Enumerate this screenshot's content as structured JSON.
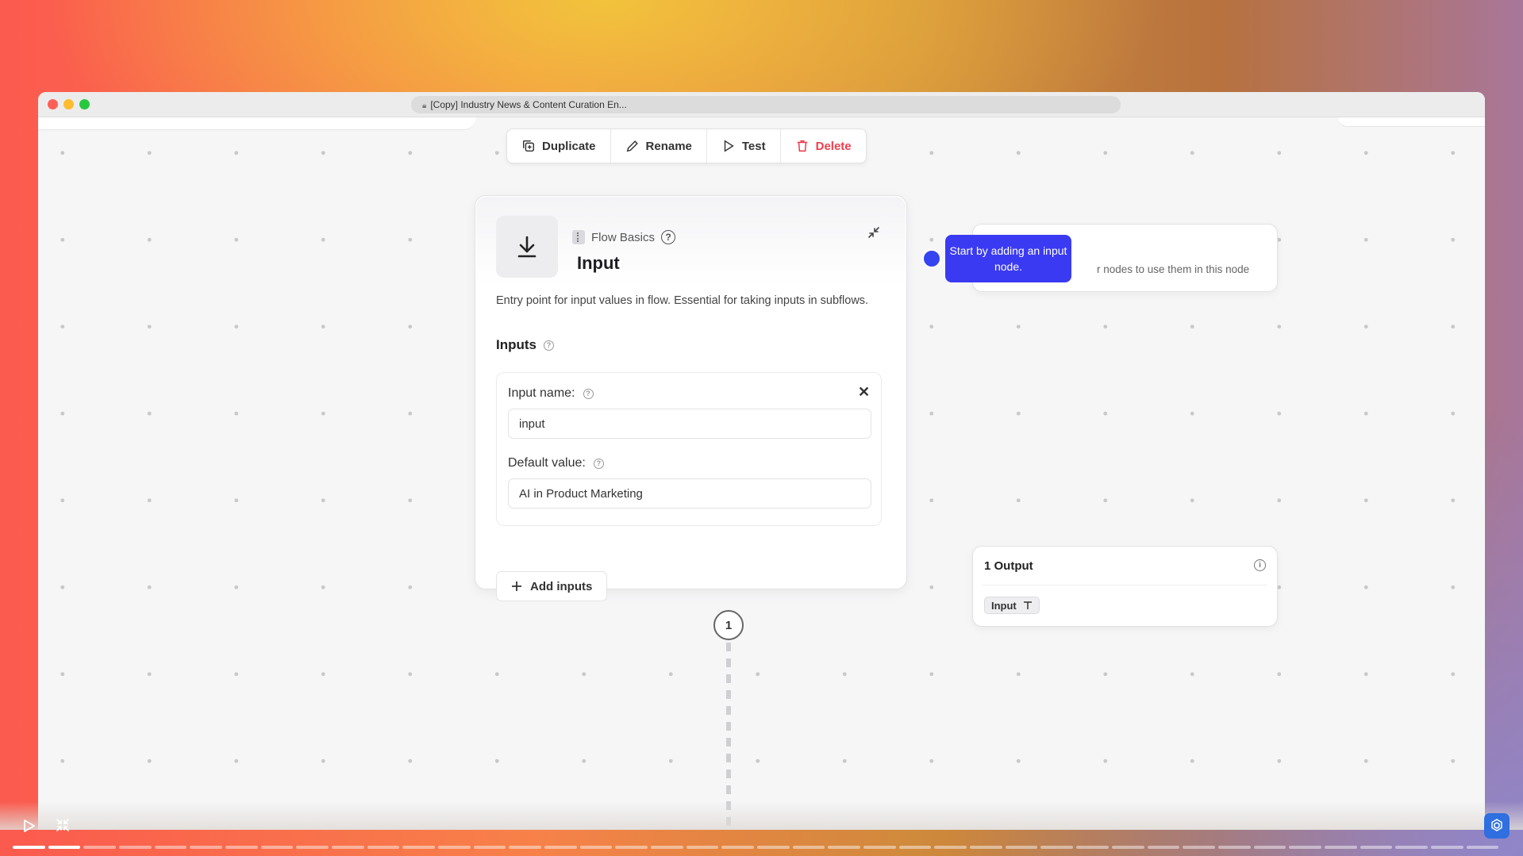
{
  "window": {
    "url_title": "[Copy] Industry News & Content Curation En..."
  },
  "toolbar": {
    "duplicate": "Duplicate",
    "rename": "Rename",
    "test": "Test",
    "delete": "Delete",
    "delete_color": "#ee3e4e"
  },
  "node": {
    "category": "Flow Basics",
    "title": "Input",
    "description": "Entry point for input values in flow. Essential for taking inputs in subflows.",
    "inputs_label": "Inputs",
    "input_name_label": "Input name:",
    "input_name_value": "input",
    "default_value_label": "Default value:",
    "default_value_value": "AI in Product Marketing",
    "add_inputs": "Add inputs",
    "badge": "1"
  },
  "tooltip": {
    "text": "Start by adding an input node.",
    "color": "#3a3af2"
  },
  "side_panel": {
    "partial_text": "r nodes to use them in this node",
    "output_title": "1 Output",
    "output_chip": "Input"
  },
  "player": {
    "segments_total": 42,
    "segments_done": 2,
    "accent": "#2f6fe0"
  }
}
